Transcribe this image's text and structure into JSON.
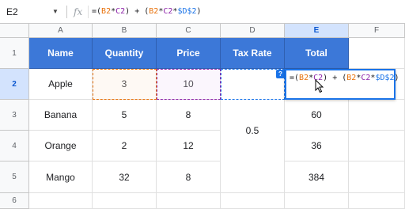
{
  "formula_bar": {
    "name_box": "E2",
    "fx_label": "fx",
    "formula_prefix": "=(",
    "ref_b2": "B2",
    "op_mul": "*",
    "ref_c2": "C2",
    "mid": ") + (",
    "ref_b2_2": "B2",
    "op_mul2": "*",
    "ref_c2_2": "C2",
    "op_mul3": "*",
    "ref_d2": "$D$2",
    "suffix": ")"
  },
  "columns": [
    "A",
    "B",
    "C",
    "D",
    "E",
    "F"
  ],
  "rows": [
    "1",
    "2",
    "3",
    "4",
    "5",
    "6"
  ],
  "table": {
    "headers": [
      "Name",
      "Quantity",
      "Price",
      "Tax Rate",
      "Total"
    ],
    "rows": [
      {
        "name": "Apple",
        "quantity": "3",
        "price": "10",
        "total": ""
      },
      {
        "name": "Banana",
        "quantity": "5",
        "price": "8",
        "total": "60"
      },
      {
        "name": "Orange",
        "quantity": "2",
        "price": "12",
        "total": "36"
      },
      {
        "name": "Mango",
        "quantity": "32",
        "price": "8",
        "total": "384"
      }
    ],
    "tax_rate": "0.5"
  },
  "editor": {
    "help": "?",
    "text_prefix": "=(",
    "ref_b2": "B2",
    "op_mul": "*",
    "ref_c2": "C2",
    "mid": ") + (",
    "ref_b2_2": "B2",
    "op_mul2": "*",
    "ref_c2_2": "C2",
    "op_mul3": "*",
    "ref_d2": "$D$2",
    "suffix": ")"
  },
  "colors": {
    "header_fill": "#3c78d8",
    "ref_orange": "#e8710a",
    "ref_purple": "#8e24aa",
    "ref_blue": "#1a73e8",
    "selection": "#d3e3fd"
  },
  "icons": {
    "name_box_dropdown": "triangle-down",
    "cursor": "mouse-pointer"
  }
}
